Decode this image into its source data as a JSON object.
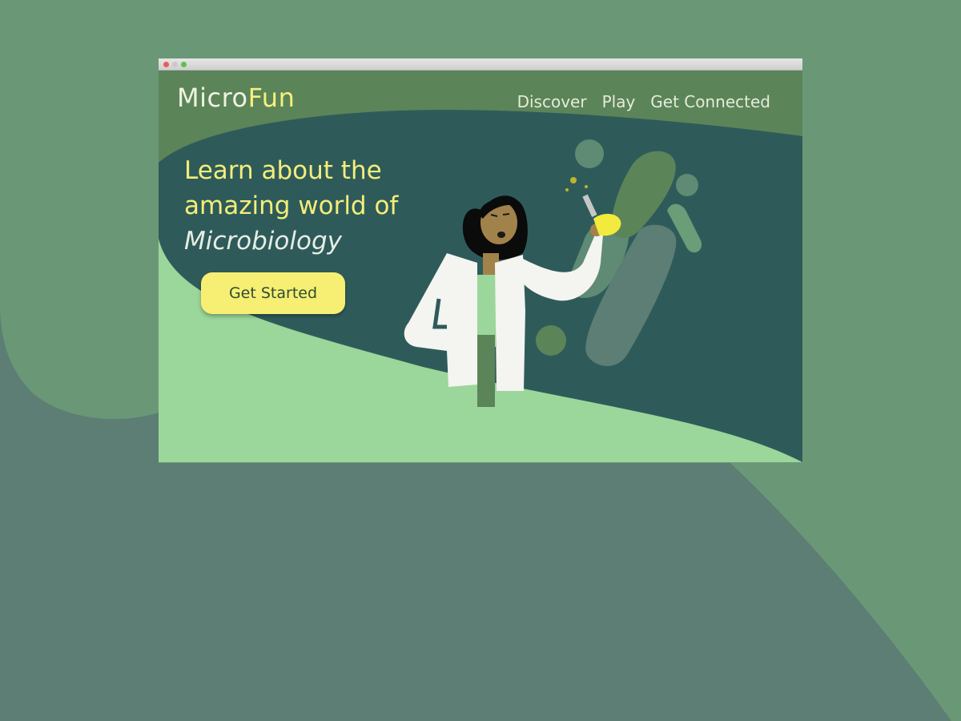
{
  "colors": {
    "page_bg": "#5c7e74",
    "header_bg": "#5b8459",
    "hero_bg": "#2e5b5a",
    "light_green": "#9bd69a",
    "accent_yellow": "#f6f07c"
  },
  "brand": {
    "micro": "Micro",
    "fun": "Fun"
  },
  "nav": {
    "items": [
      "Discover",
      "Play",
      "Get Connected"
    ]
  },
  "hero": {
    "headline_lines": [
      "Learn about the",
      "amazing world of",
      "Microbiology"
    ],
    "cta_label": "Get Started"
  },
  "illustration": {
    "subject": "scientist-in-lab-coat",
    "icons": [
      "flask-icon",
      "microbe-icon"
    ]
  }
}
